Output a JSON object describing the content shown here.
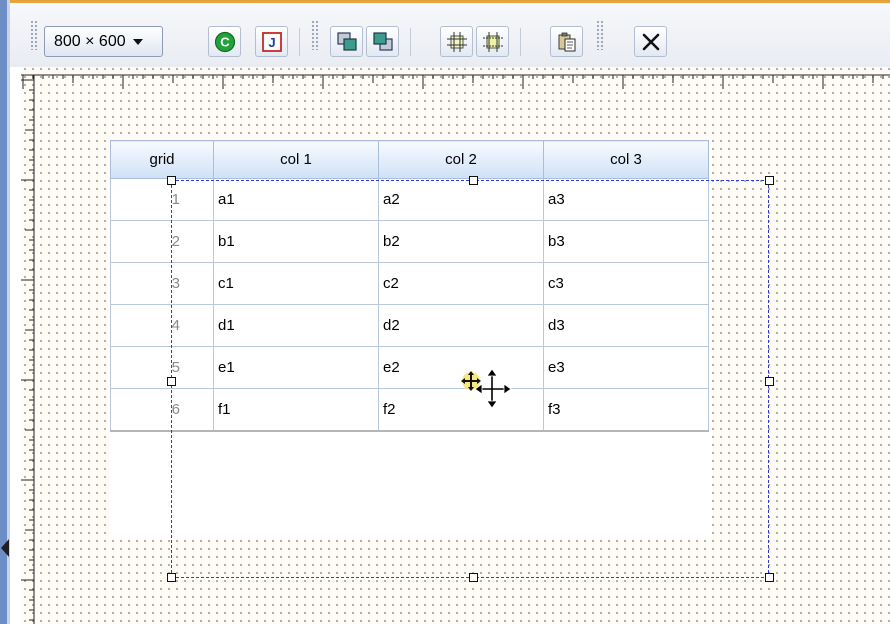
{
  "toolbar": {
    "resolution": "800 × 600",
    "buttons": [
      {
        "name": "c-button",
        "glyph": "C"
      },
      {
        "name": "j-button",
        "glyph": "J"
      },
      {
        "name": "bring-to-front-button"
      },
      {
        "name": "send-to-back-button"
      },
      {
        "name": "align-horizontal-button"
      },
      {
        "name": "align-vertical-button"
      },
      {
        "name": "paste-button"
      },
      {
        "name": "delete-button"
      }
    ]
  },
  "grid": {
    "headers": [
      "grid",
      "col 1",
      "col 2",
      "col 3"
    ],
    "rows": [
      [
        "1",
        "a1",
        "a2",
        "a3"
      ],
      [
        "2",
        "b1",
        "b2",
        "b3"
      ],
      [
        "3",
        "c1",
        "c2",
        "c3"
      ],
      [
        "4",
        "d1",
        "d2",
        "d3"
      ],
      [
        "5",
        "e1",
        "e2",
        "e3"
      ],
      [
        "6",
        "f1",
        "f2",
        "f3"
      ]
    ]
  },
  "colors": {
    "frame": "#6d8ec4",
    "accent_top": "#e8a33d",
    "selection": "#2d3cd8",
    "header_bg": "#cfe1f7",
    "canvas_bg": "#fefcf5"
  }
}
